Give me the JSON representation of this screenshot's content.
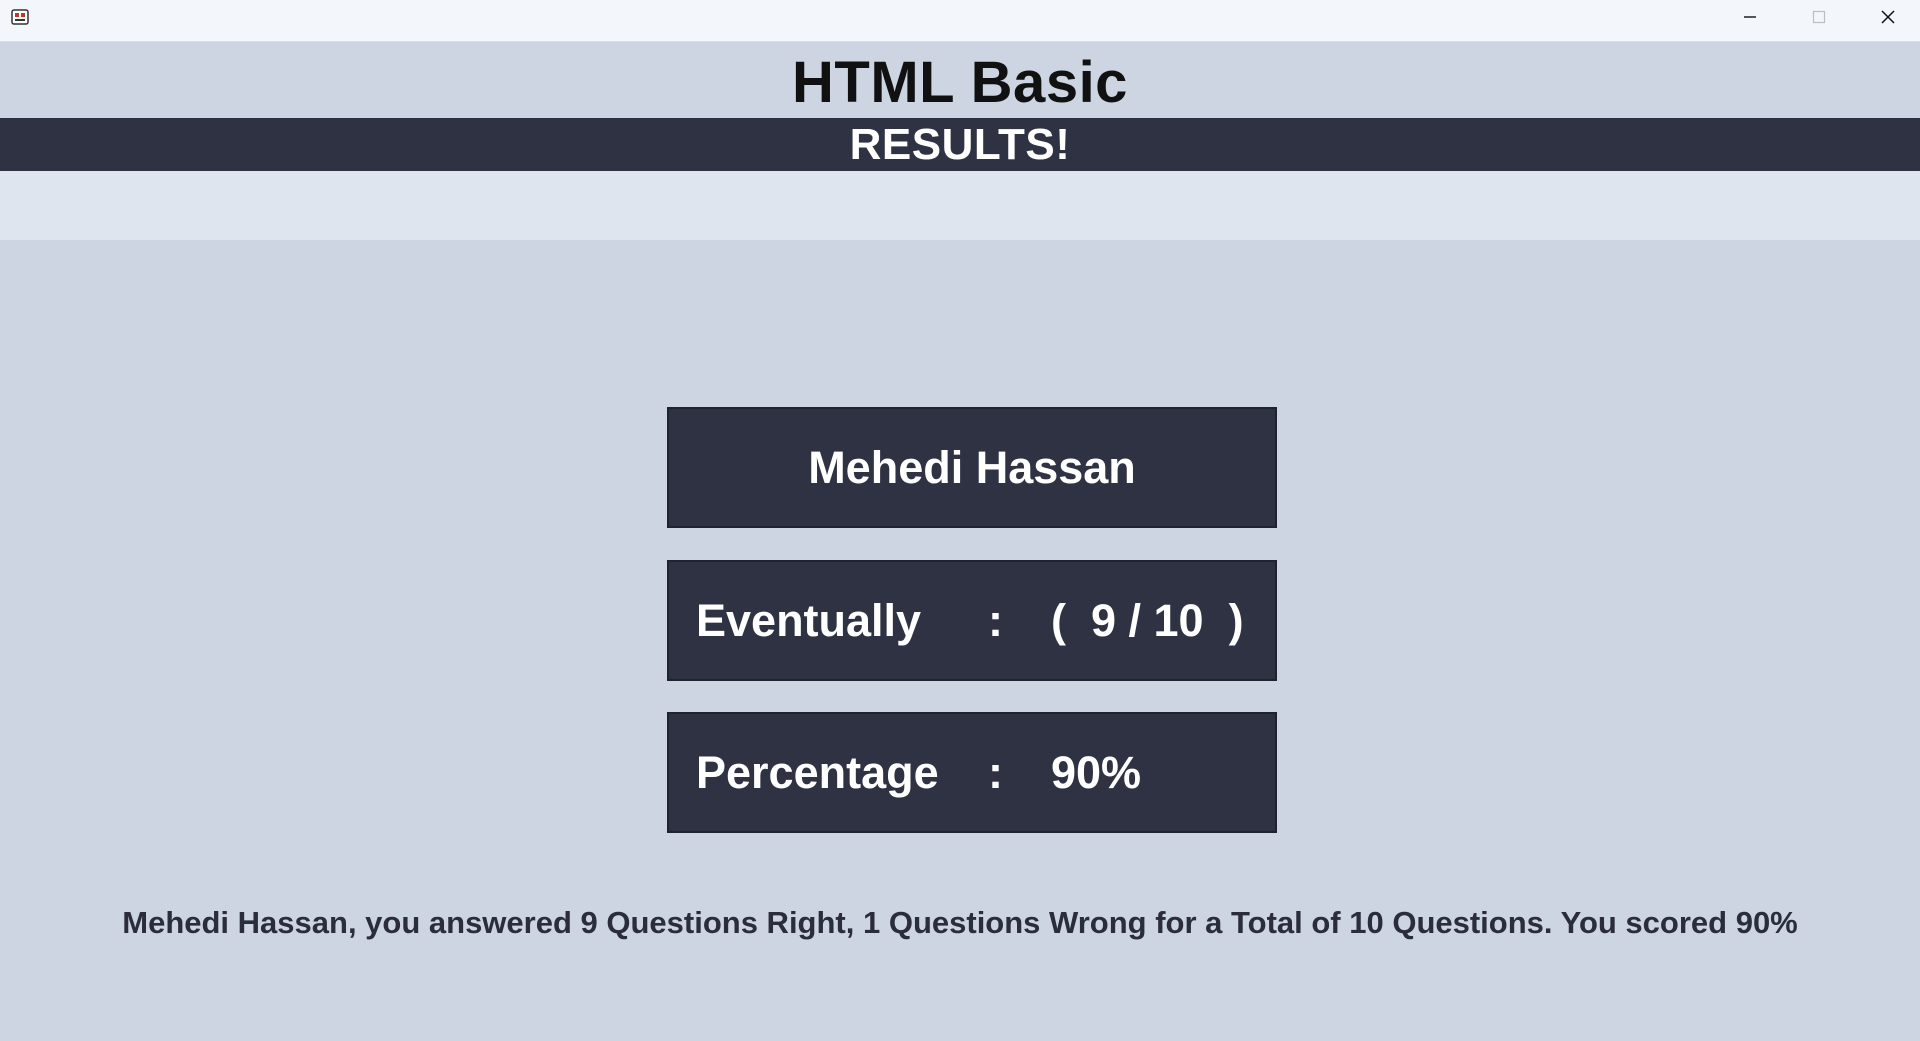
{
  "window": {
    "icon": "app-icon",
    "controls": {
      "minimize_icon": "minimize-icon",
      "maximize_icon": "maximize-icon",
      "close_icon": "close-icon"
    }
  },
  "header": {
    "title": "HTML Basic",
    "subtitle": "RESULTS!"
  },
  "result": {
    "name": "Mehedi Hassan",
    "score_label": "Eventually",
    "score_separator": ":",
    "score_value": "(  9 / 10  )",
    "score_correct": 9,
    "score_total": 10,
    "percentage_label": "Percentage",
    "percentage_separator": ":",
    "percentage_value": "90%"
  },
  "summary": "Mehedi Hassan, you answered 9 Questions Right, 1 Questions Wrong for a Total of 10 Questions. You scored 90%",
  "colors": {
    "background": "#cdd5e3",
    "card": "#2f3242",
    "titlebar": "#f3f6fb",
    "light_band": "#dfe5ee"
  }
}
